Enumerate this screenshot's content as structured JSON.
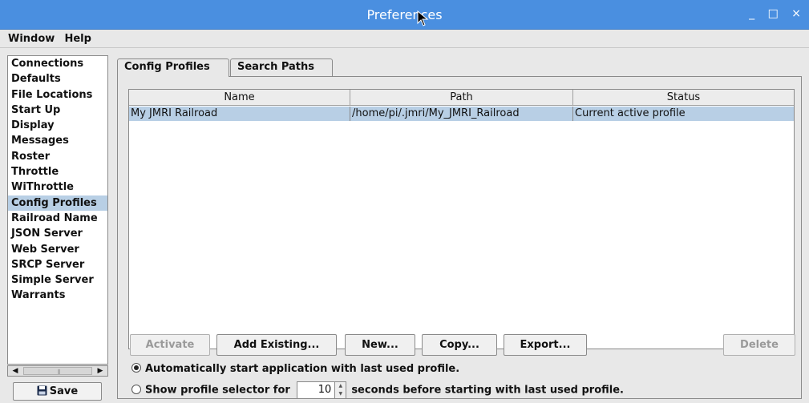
{
  "window": {
    "title": "Preferences",
    "controls": [
      "_",
      "□",
      "×"
    ]
  },
  "menubar": [
    "Window",
    "Help"
  ],
  "sidebar": {
    "items": [
      {
        "label": "Connections"
      },
      {
        "label": "Defaults"
      },
      {
        "label": "File Locations"
      },
      {
        "label": "Start Up"
      },
      {
        "label": "Display"
      },
      {
        "label": "Messages"
      },
      {
        "label": "Roster"
      },
      {
        "label": "Throttle"
      },
      {
        "label": "WiThrottle"
      },
      {
        "label": "Config Profiles",
        "selected": true
      },
      {
        "label": "Railroad Name"
      },
      {
        "label": "JSON Server"
      },
      {
        "label": "Web Server"
      },
      {
        "label": "SRCP Server"
      },
      {
        "label": "Simple Server"
      },
      {
        "label": "Warrants"
      }
    ],
    "save_label": "Save",
    "save_icon": "floppy-disk-icon"
  },
  "tabs": [
    {
      "label": "Config Profiles",
      "active": true
    },
    {
      "label": "Search Paths",
      "active": false
    }
  ],
  "table": {
    "columns": [
      "Name",
      "Path",
      "Status"
    ],
    "rows": [
      {
        "name": "My JMRI Railroad",
        "path": "/home/pi/.jmri/My_JMRI_Railroad",
        "status": "Current active profile",
        "selected": true
      }
    ]
  },
  "buttons": {
    "activate": "Activate",
    "add_existing": "Add Existing...",
    "new": "New...",
    "copy": "Copy...",
    "export": "Export...",
    "delete": "Delete"
  },
  "options": {
    "auto_start": "Automatically start application with last used profile.",
    "show_selector_prefix": "Show profile selector for",
    "seconds_value": "10",
    "show_selector_suffix": "seconds before starting with last used profile.",
    "selected": "auto_start"
  },
  "colors": {
    "titlebar": "#4a8fe0",
    "selection": "#b8cfe5"
  }
}
